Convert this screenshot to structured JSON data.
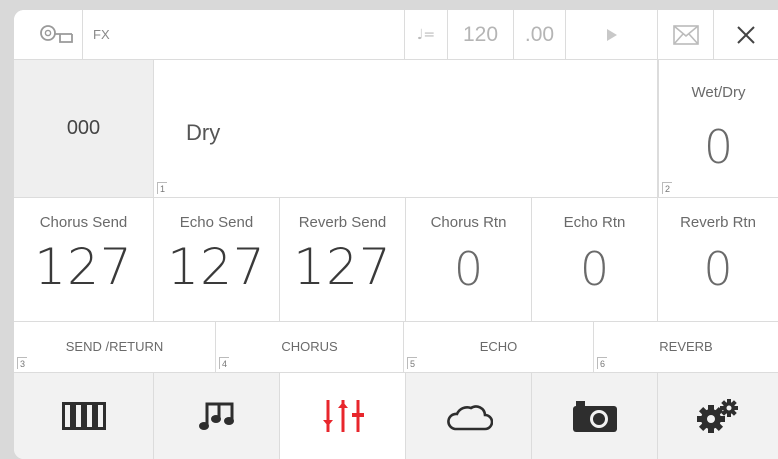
{
  "header": {
    "title": "FX",
    "tempo_symbol": "♩=",
    "tempo": "120",
    "tempo_decimal": ".00"
  },
  "preset": {
    "number": "000",
    "name": "Dry",
    "index": "1"
  },
  "wet_dry": {
    "label": "Wet/Dry",
    "value": "0",
    "index": "2"
  },
  "params": [
    {
      "label": "Chorus Send",
      "value": "127"
    },
    {
      "label": "Echo Send",
      "value": "127"
    },
    {
      "label": "Reverb Send",
      "value": "127"
    },
    {
      "label": "Chorus Rtn",
      "value": "0"
    },
    {
      "label": "Echo Rtn",
      "value": "0"
    },
    {
      "label": "Reverb Rtn",
      "value": "0"
    }
  ],
  "tabs": [
    {
      "label": "SEND /RETURN",
      "index": "3"
    },
    {
      "label": "CHORUS",
      "index": "4"
    },
    {
      "label": "ECHO",
      "index": "5"
    },
    {
      "label": "REVERB",
      "index": "6"
    }
  ],
  "nav": {
    "items": [
      {
        "icon": "piano-keys-icon"
      },
      {
        "icon": "music-notes-icon"
      },
      {
        "icon": "mixer-sliders-icon"
      },
      {
        "icon": "cloud-icon"
      },
      {
        "icon": "camera-icon"
      },
      {
        "icon": "gears-icon"
      }
    ],
    "active_index": 2,
    "active_color": "#e8262c"
  }
}
